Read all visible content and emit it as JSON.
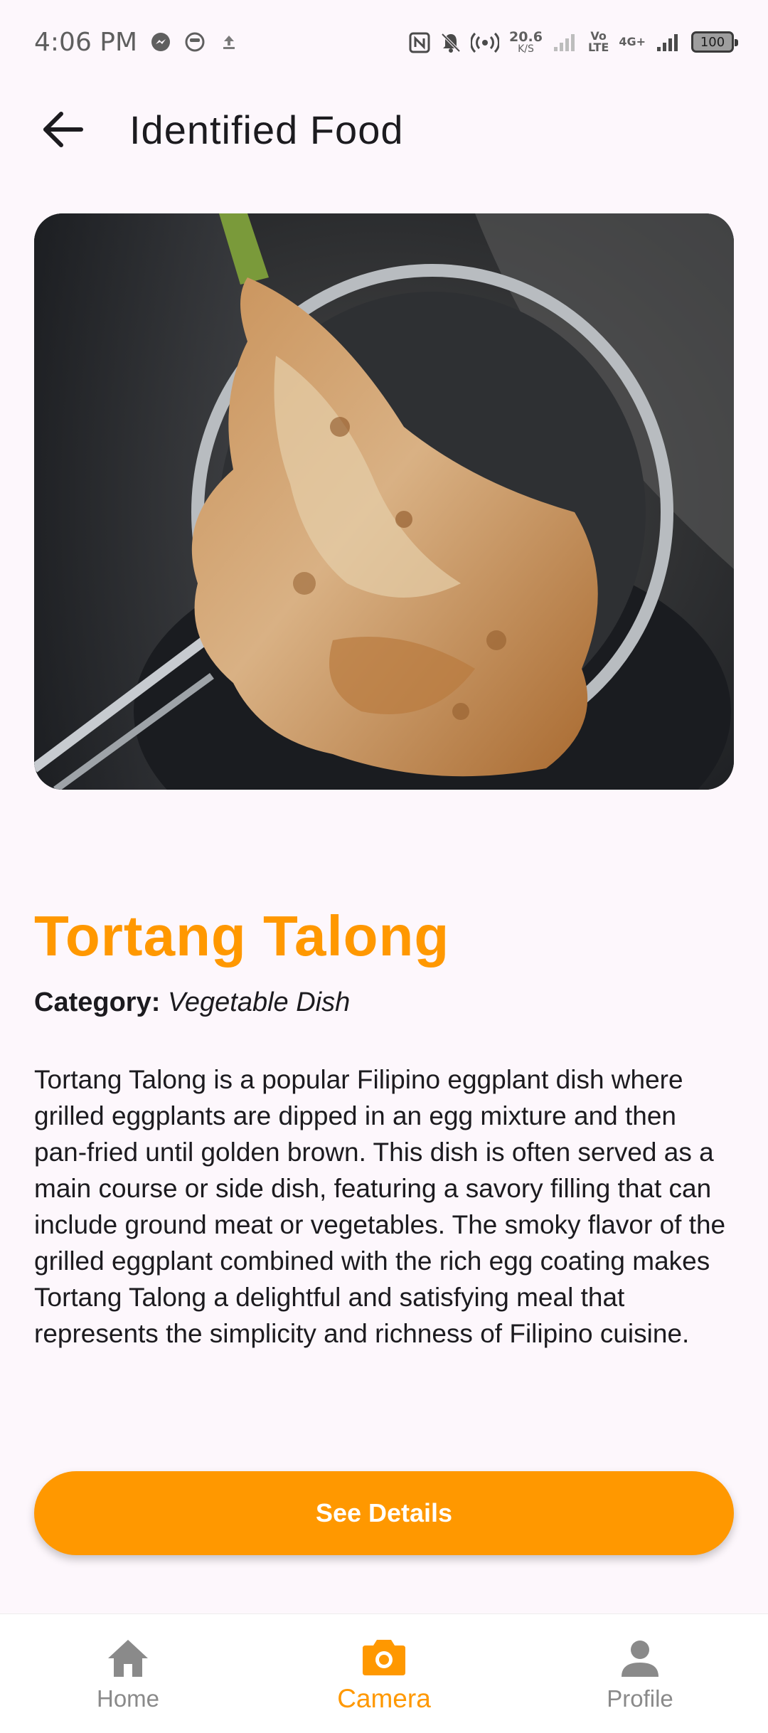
{
  "status_bar": {
    "time": "4:06 PM",
    "net_speed_value": "20.6",
    "net_speed_unit": "K/S",
    "volte_top": "Vo",
    "volte_bottom": "LTE",
    "network": "4G+",
    "battery": "100",
    "icons": [
      "messenger-icon",
      "smiley-icon",
      "upload-icon",
      "nfc-icon",
      "bell-off-icon",
      "hotspot-icon",
      "signal-icon",
      "signal-icon"
    ]
  },
  "app_bar": {
    "title": "Identified Food",
    "back_icon": "arrow-back-icon"
  },
  "food": {
    "name": "Tortang Talong",
    "category_label": "Category:",
    "category_value": "Vegetable Dish",
    "description": "Tortang Talong is a popular Filipino eggplant dish where grilled eggplants are dipped in an egg mixture and then pan-fried until golden brown. This dish is often served as a main course or side dish, featuring a savory filling that can include ground meat or vegetables. The smoky flavor of the grilled eggplant combined with the rich egg coating makes Tortang Talong a delightful and satisfying meal that represents the simplicity and richness of Filipino cuisine."
  },
  "actions": {
    "see_details_label": "See Details"
  },
  "bottom_nav": {
    "items": [
      {
        "label": "Home",
        "icon": "home-icon",
        "active": false
      },
      {
        "label": "Camera",
        "icon": "camera-icon",
        "active": true
      },
      {
        "label": "Profile",
        "icon": "person-icon",
        "active": false
      }
    ]
  },
  "colors": {
    "accent": "#ff9800",
    "background": "#fdf7fc",
    "inactive": "#8a8a8a"
  }
}
